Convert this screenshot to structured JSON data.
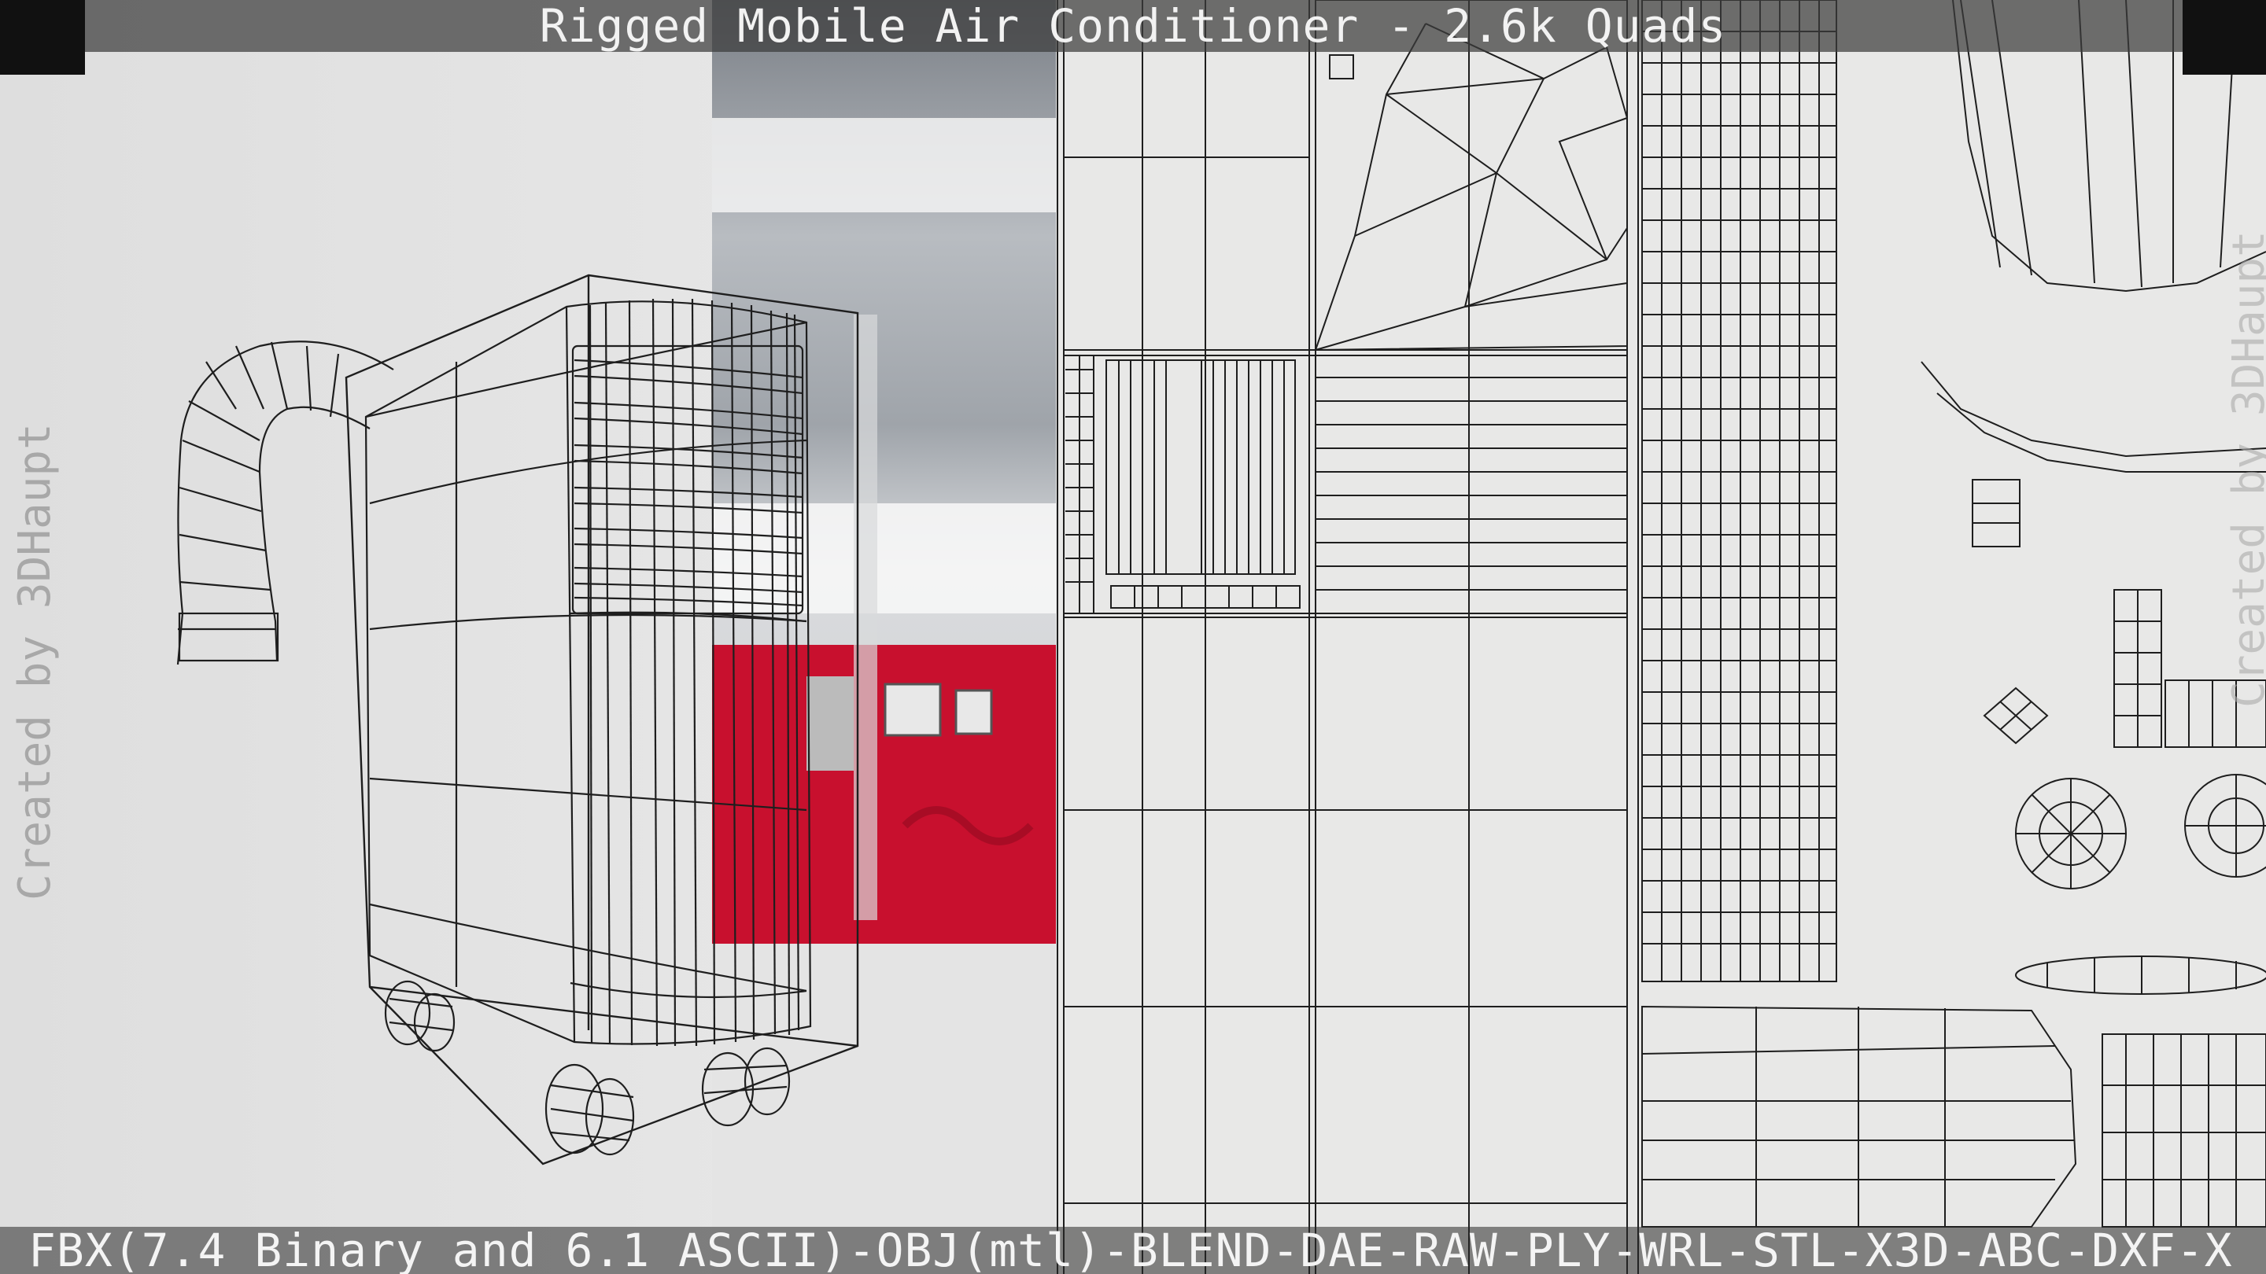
{
  "header": {
    "title": "Rigged Mobile Air Conditioner - 2.6k Quads"
  },
  "footer": {
    "formats": "FBX(7.4 Binary and 6.1 ASCII)-OBJ(mtl)-BLEND-DAE-RAW-PLY-WRL-STL-X3D-ABC-DXF-X"
  },
  "watermarks": {
    "left": "Created by 3DHaupt",
    "right": "Created by 3DHaupt"
  },
  "colors": {
    "wire": "#1e1e1e",
    "red_wall": "#c8102e",
    "bar": "#3c3c3c"
  }
}
